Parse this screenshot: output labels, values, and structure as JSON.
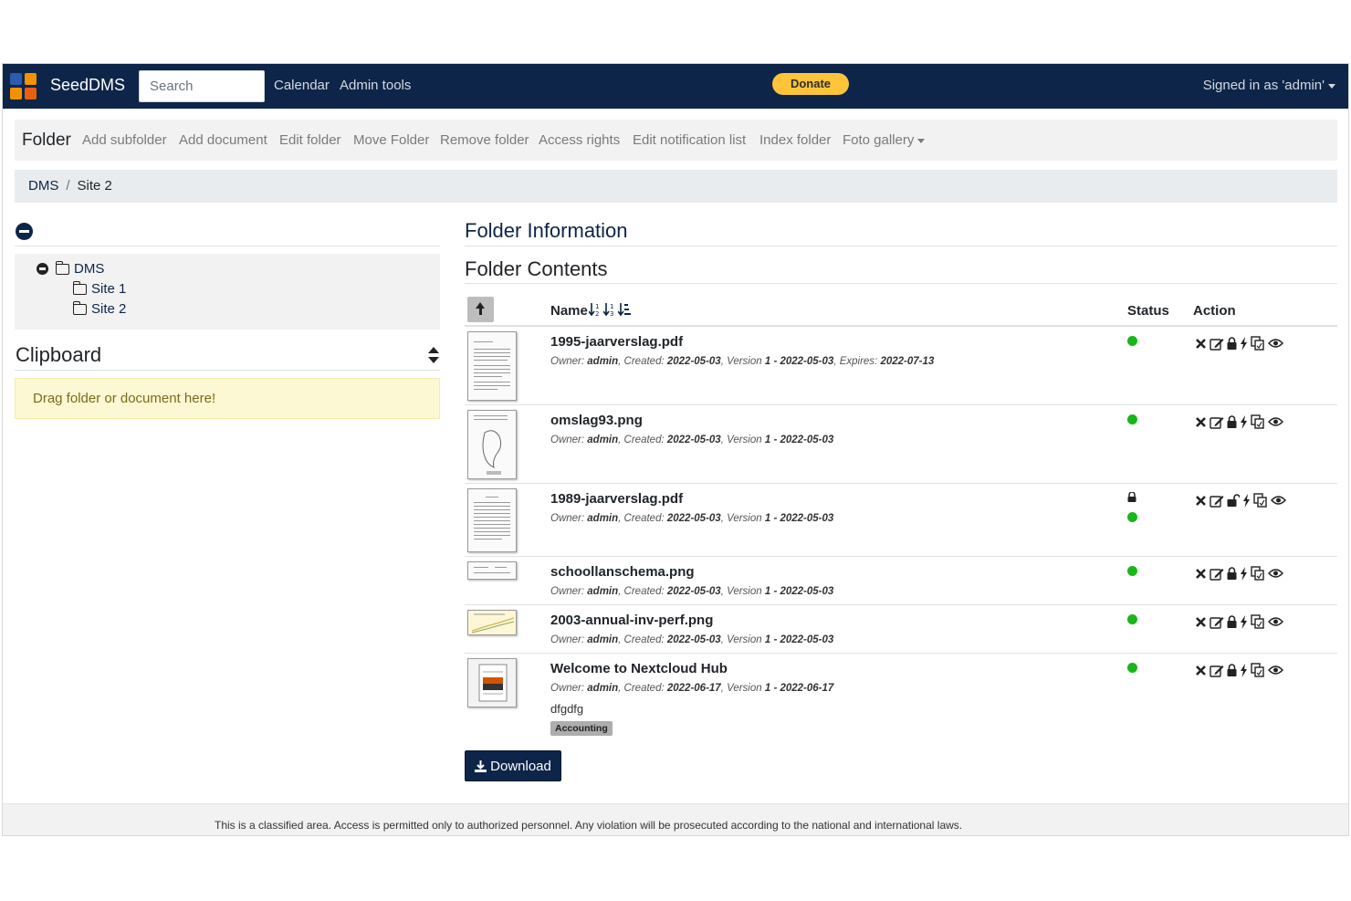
{
  "app": {
    "brand": "SeedDMS"
  },
  "navbar": {
    "search_placeholder": "Search",
    "links": [
      "Calendar",
      "Admin tools"
    ],
    "donate_label": "Donate",
    "signed_in": "Signed in as 'admin'",
    "logo_colors": [
      "#2a5db0",
      "#f39200",
      "#f39200",
      "#e95f10"
    ],
    "bg_color": "#0d2549"
  },
  "folder_menu": {
    "title": "Folder",
    "actions": [
      "Add subfolder",
      "Add document",
      "Edit folder",
      "Move Folder",
      "Remove folder",
      "Access rights",
      "Edit notification list",
      "Index folder",
      "Foto gallery"
    ]
  },
  "breadcrumb": {
    "root": "DMS",
    "separator": "/",
    "current": "Site 2"
  },
  "tree": {
    "root": "DMS",
    "children": [
      "Site 1",
      "Site 2"
    ]
  },
  "clipboard": {
    "title": "Clipboard",
    "dropzone": "Drag folder or document here!"
  },
  "main": {
    "folder_info_title": "Folder Information",
    "folder_contents_title": "Folder Contents",
    "columns": {
      "name": "Name",
      "status": "Status",
      "action": "Action"
    }
  },
  "documents": [
    {
      "name": "1995-jaarverslag.pdf",
      "owner_label": "Owner:",
      "owner": "admin",
      "created_label": ", Created:",
      "created": "2022-05-03",
      "version_label": ", Version",
      "version": "1 - 2022-05-03",
      "expires_label": ", Expires:",
      "expires": "2022-07-13",
      "locked": false
    },
    {
      "name": "omslag93.png",
      "owner_label": "Owner:",
      "owner": "admin",
      "created_label": ", Created:",
      "created": "2022-05-03",
      "version_label": ", Version",
      "version": "1 - 2022-05-03",
      "locked": false
    },
    {
      "name": "1989-jaarverslag.pdf",
      "owner_label": "Owner:",
      "owner": "admin",
      "created_label": ", Created:",
      "created": "2022-05-03",
      "version_label": ", Version",
      "version": "1 - 2022-05-03",
      "locked": true
    },
    {
      "name": "schoollanschema.png",
      "owner_label": "Owner:",
      "owner": "admin",
      "created_label": ", Created:",
      "created": "2022-05-03",
      "version_label": ", Version",
      "version": "1 - 2022-05-03",
      "locked": false
    },
    {
      "name": "2003-annual-inv-perf.png",
      "owner_label": "Owner:",
      "owner": "admin",
      "created_label": ", Created:",
      "created": "2022-05-03",
      "version_label": ", Version",
      "version": "1 - 2022-05-03",
      "locked": false
    },
    {
      "name": "Welcome to Nextcloud Hub",
      "owner_label": "Owner:",
      "owner": "admin",
      "created_label": ", Created:",
      "created": "2022-06-17",
      "version_label": ", Version",
      "version": "1 - 2022-06-17",
      "comment": "dfgdfg",
      "category": "Accounting",
      "locked": false
    }
  ],
  "status_color": "#18b618",
  "download_label": "Download",
  "footer_text": "This is a classified area. Access is permitted only to authorized personnel. Any violation will be prosecuted according to the national and international laws."
}
